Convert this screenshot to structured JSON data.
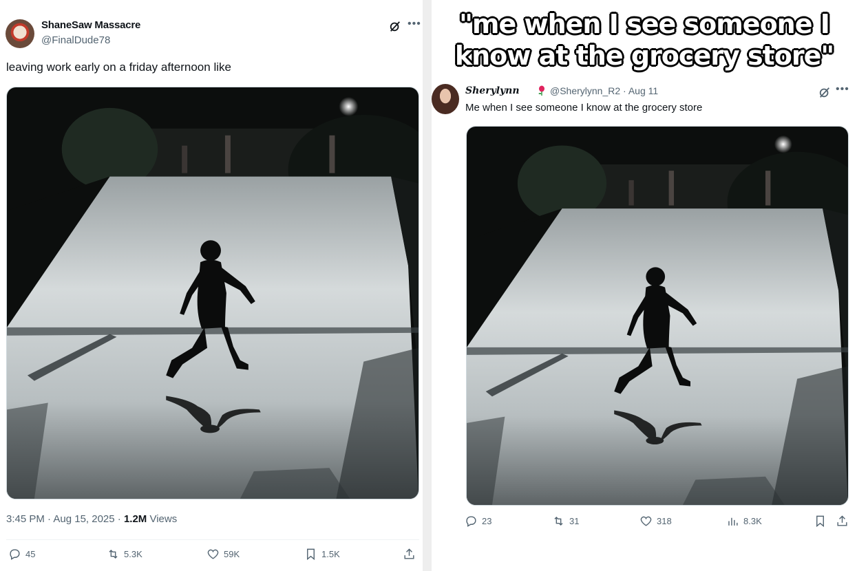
{
  "left_tweet": {
    "display_name": "ShaneSaw Massacre",
    "handle": "@FinalDude78",
    "text": "leaving work early on a friday afternoon like",
    "timestamp": "3:45 PM · Aug 15, 2025 · ",
    "views_count": "1.2M",
    "views_label": " Views",
    "replies": "45",
    "reposts": "5.3K",
    "likes": "59K",
    "bookmarks": "1.5K"
  },
  "right_tweet": {
    "caption_line1": "\"me when I see someone I",
    "caption_line2": "know at the grocery store\"",
    "display_name": "Sherylynn",
    "handle": "@Sherylynn_R2 · Aug 11",
    "text": "Me when I see someone I know at the grocery store",
    "replies": "23",
    "reposts": "31",
    "likes": "318",
    "views": "8.3K"
  },
  "icons": [
    "grok-icon",
    "more-icon",
    "reply-icon",
    "repost-icon",
    "like-icon",
    "bookmark-icon",
    "share-icon",
    "views-icon",
    "flower-icon"
  ]
}
